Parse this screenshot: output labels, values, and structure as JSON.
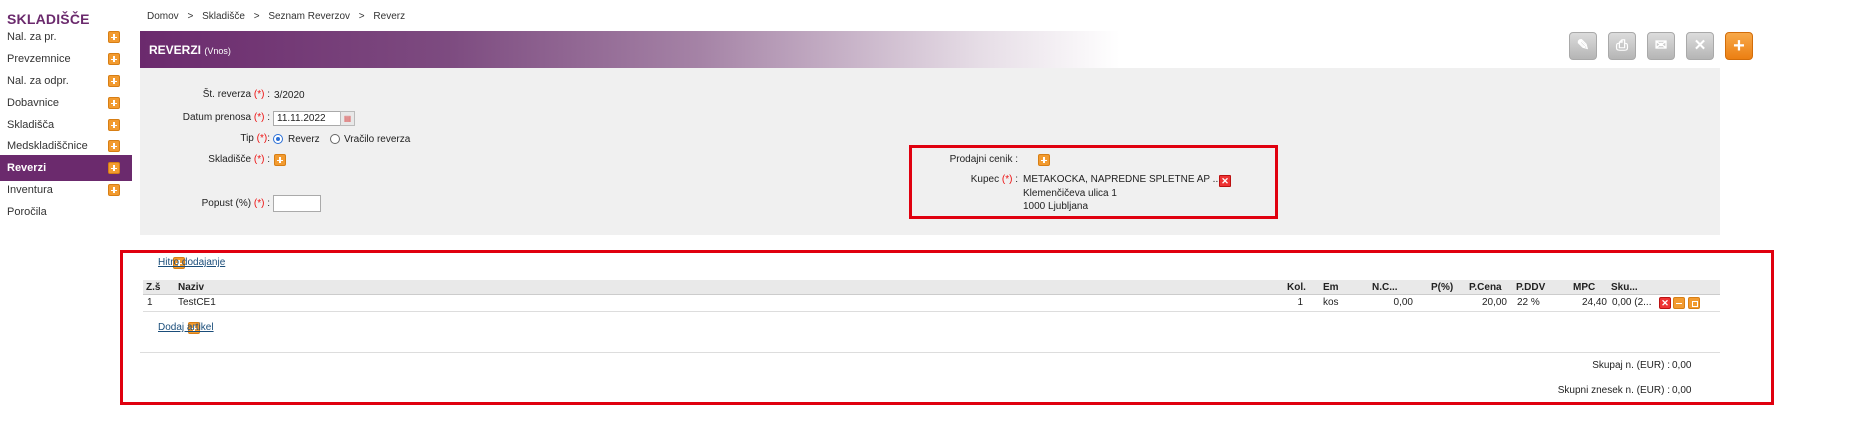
{
  "sidebar": {
    "title": "SKLADIŠČE",
    "items": [
      {
        "label": "Nal. za pr.",
        "has_add": true,
        "active": false
      },
      {
        "label": "Prevzemnice",
        "has_add": true,
        "active": false
      },
      {
        "label": "Nal. za odpr.",
        "has_add": true,
        "active": false
      },
      {
        "label": "Dobavnice",
        "has_add": true,
        "active": false
      },
      {
        "label": "Skladišča",
        "has_add": true,
        "active": false
      },
      {
        "label": "Medskladiščnice",
        "has_add": true,
        "active": false
      },
      {
        "label": "Reverzi",
        "has_add": true,
        "active": true
      },
      {
        "label": "Inventura",
        "has_add": true,
        "active": false
      },
      {
        "label": "Poročila",
        "has_add": false,
        "active": false
      }
    ]
  },
  "breadcrumb": [
    "Domov",
    ">",
    "Skladišče",
    ">",
    "Seznam Reverzov",
    ">",
    "Reverz"
  ],
  "header": {
    "title": "REVERZI",
    "subtitle": "(Vnos)"
  },
  "toolbar": {
    "buttons": [
      {
        "name": "edit-button",
        "icon": "pencil-icon"
      },
      {
        "name": "print-button",
        "icon": "printer-icon"
      },
      {
        "name": "email-button",
        "icon": "envelope-icon"
      },
      {
        "name": "delete-button",
        "icon": "close-icon"
      },
      {
        "name": "add-button",
        "icon": "plus-icon"
      }
    ]
  },
  "form": {
    "stevilka_label": "Št. reverza",
    "stevilka_value": "3/2020",
    "datum_label": "Datum prenosa",
    "datum_value": "11.11.2022",
    "tip_label": "Tip",
    "tip_options": [
      "Reverz",
      "Vračilo reverza"
    ],
    "tip_selected": "Reverz",
    "skladisce_label": "Skladišče",
    "popust_label": "Popust (%)",
    "popust_value": "",
    "required_marker": "(*)",
    "cenik_label": "Prodajni cenik :",
    "kupec_label": "Kupec",
    "kupec_name": "METAKOCKA, NAPREDNE SPLETNE AP ...",
    "kupec_address1": "Klemenčičeva ulica 1",
    "kupec_address2": "1000 Ljubljana"
  },
  "items": {
    "quick_add_label": "Hitro dodajanje",
    "columns": [
      "Z.š",
      "Naziv",
      "Kol.",
      "Em",
      "N.C...",
      "P(%)",
      "P.Cena",
      "P.DDV",
      "MPC",
      "Sku..."
    ],
    "rows": [
      {
        "zs": "1",
        "naziv": "TestCE1",
        "kol": "1",
        "em": "kos",
        "nc": "0,00",
        "p": "",
        "pcena": "20,00",
        "pddv": "22 %",
        "mpc": "24,40",
        "sku": "0,00 (2..."
      }
    ],
    "add_article_label": "Dodaj artikel"
  },
  "totals": {
    "skupaj_label": "Skupaj n. (EUR) :",
    "skupaj_value": "0,00",
    "znesek_label": "Skupni znesek n. (EUR) :",
    "znesek_value": "0,00"
  },
  "colors": {
    "brand": "#6b2a6d",
    "accent": "#f29b30",
    "highlight": "#e0000f"
  }
}
